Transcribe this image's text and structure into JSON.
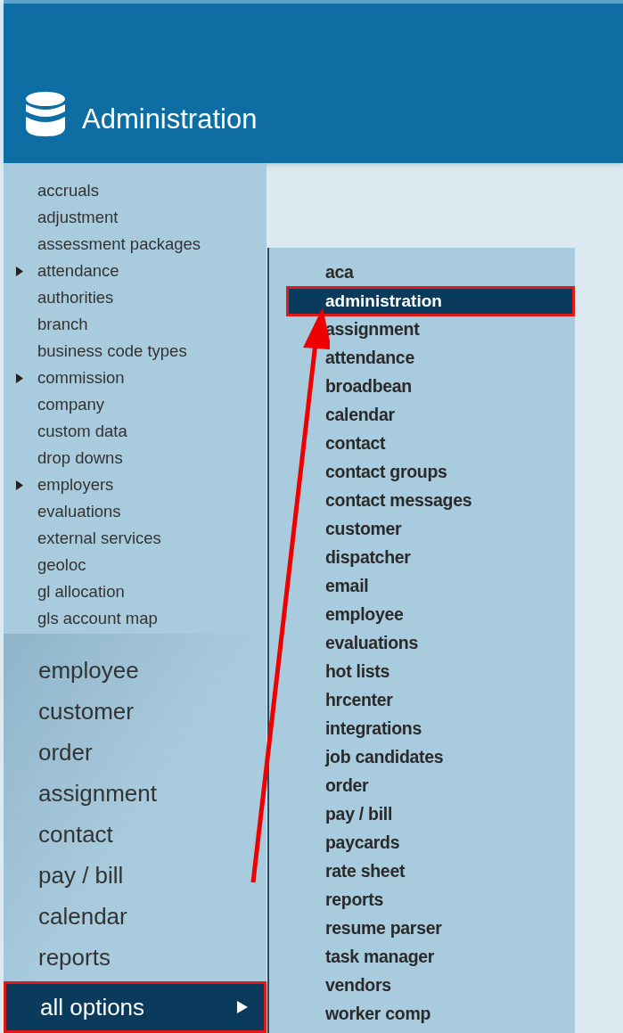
{
  "header": {
    "title": "Administration"
  },
  "admin_list": [
    {
      "label": "accruals",
      "expandable": false
    },
    {
      "label": "adjustment",
      "expandable": false
    },
    {
      "label": "assessment packages",
      "expandable": false
    },
    {
      "label": "attendance",
      "expandable": true
    },
    {
      "label": "authorities",
      "expandable": false
    },
    {
      "label": "branch",
      "expandable": false
    },
    {
      "label": "business code types",
      "expandable": false
    },
    {
      "label": "commission",
      "expandable": true
    },
    {
      "label": "company",
      "expandable": false
    },
    {
      "label": "custom data",
      "expandable": false
    },
    {
      "label": "drop downs",
      "expandable": false
    },
    {
      "label": "employers",
      "expandable": true
    },
    {
      "label": "evaluations",
      "expandable": false
    },
    {
      "label": "external services",
      "expandable": false
    },
    {
      "label": "geoloc",
      "expandable": false
    },
    {
      "label": "gl allocation",
      "expandable": false
    },
    {
      "label": "gls account map",
      "expandable": false
    }
  ],
  "main_menu": [
    {
      "label": "employee",
      "selected": false
    },
    {
      "label": "customer",
      "selected": false
    },
    {
      "label": "order",
      "selected": false
    },
    {
      "label": "assignment",
      "selected": false
    },
    {
      "label": "contact",
      "selected": false
    },
    {
      "label": "pay / bill",
      "selected": false
    },
    {
      "label": "calendar",
      "selected": false
    },
    {
      "label": "reports",
      "selected": false
    },
    {
      "label": "all options",
      "selected": true
    }
  ],
  "submenu": [
    {
      "label": "aca",
      "selected": false
    },
    {
      "label": "administration",
      "selected": true
    },
    {
      "label": "assignment",
      "selected": false
    },
    {
      "label": "attendance",
      "selected": false
    },
    {
      "label": "broadbean",
      "selected": false
    },
    {
      "label": "calendar",
      "selected": false
    },
    {
      "label": "contact",
      "selected": false
    },
    {
      "label": "contact groups",
      "selected": false
    },
    {
      "label": "contact messages",
      "selected": false
    },
    {
      "label": "customer",
      "selected": false
    },
    {
      "label": "dispatcher",
      "selected": false
    },
    {
      "label": "email",
      "selected": false
    },
    {
      "label": "employee",
      "selected": false
    },
    {
      "label": "evaluations",
      "selected": false
    },
    {
      "label": "hot lists",
      "selected": false
    },
    {
      "label": "hrcenter",
      "selected": false
    },
    {
      "label": "integrations",
      "selected": false
    },
    {
      "label": "job candidates",
      "selected": false
    },
    {
      "label": "order",
      "selected": false
    },
    {
      "label": "pay / bill",
      "selected": false
    },
    {
      "label": "paycards",
      "selected": false
    },
    {
      "label": "rate sheet",
      "selected": false
    },
    {
      "label": "reports",
      "selected": false
    },
    {
      "label": "resume parser",
      "selected": false
    },
    {
      "label": "task manager",
      "selected": false
    },
    {
      "label": "vendors",
      "selected": false
    },
    {
      "label": "worker comp",
      "selected": false
    }
  ]
}
